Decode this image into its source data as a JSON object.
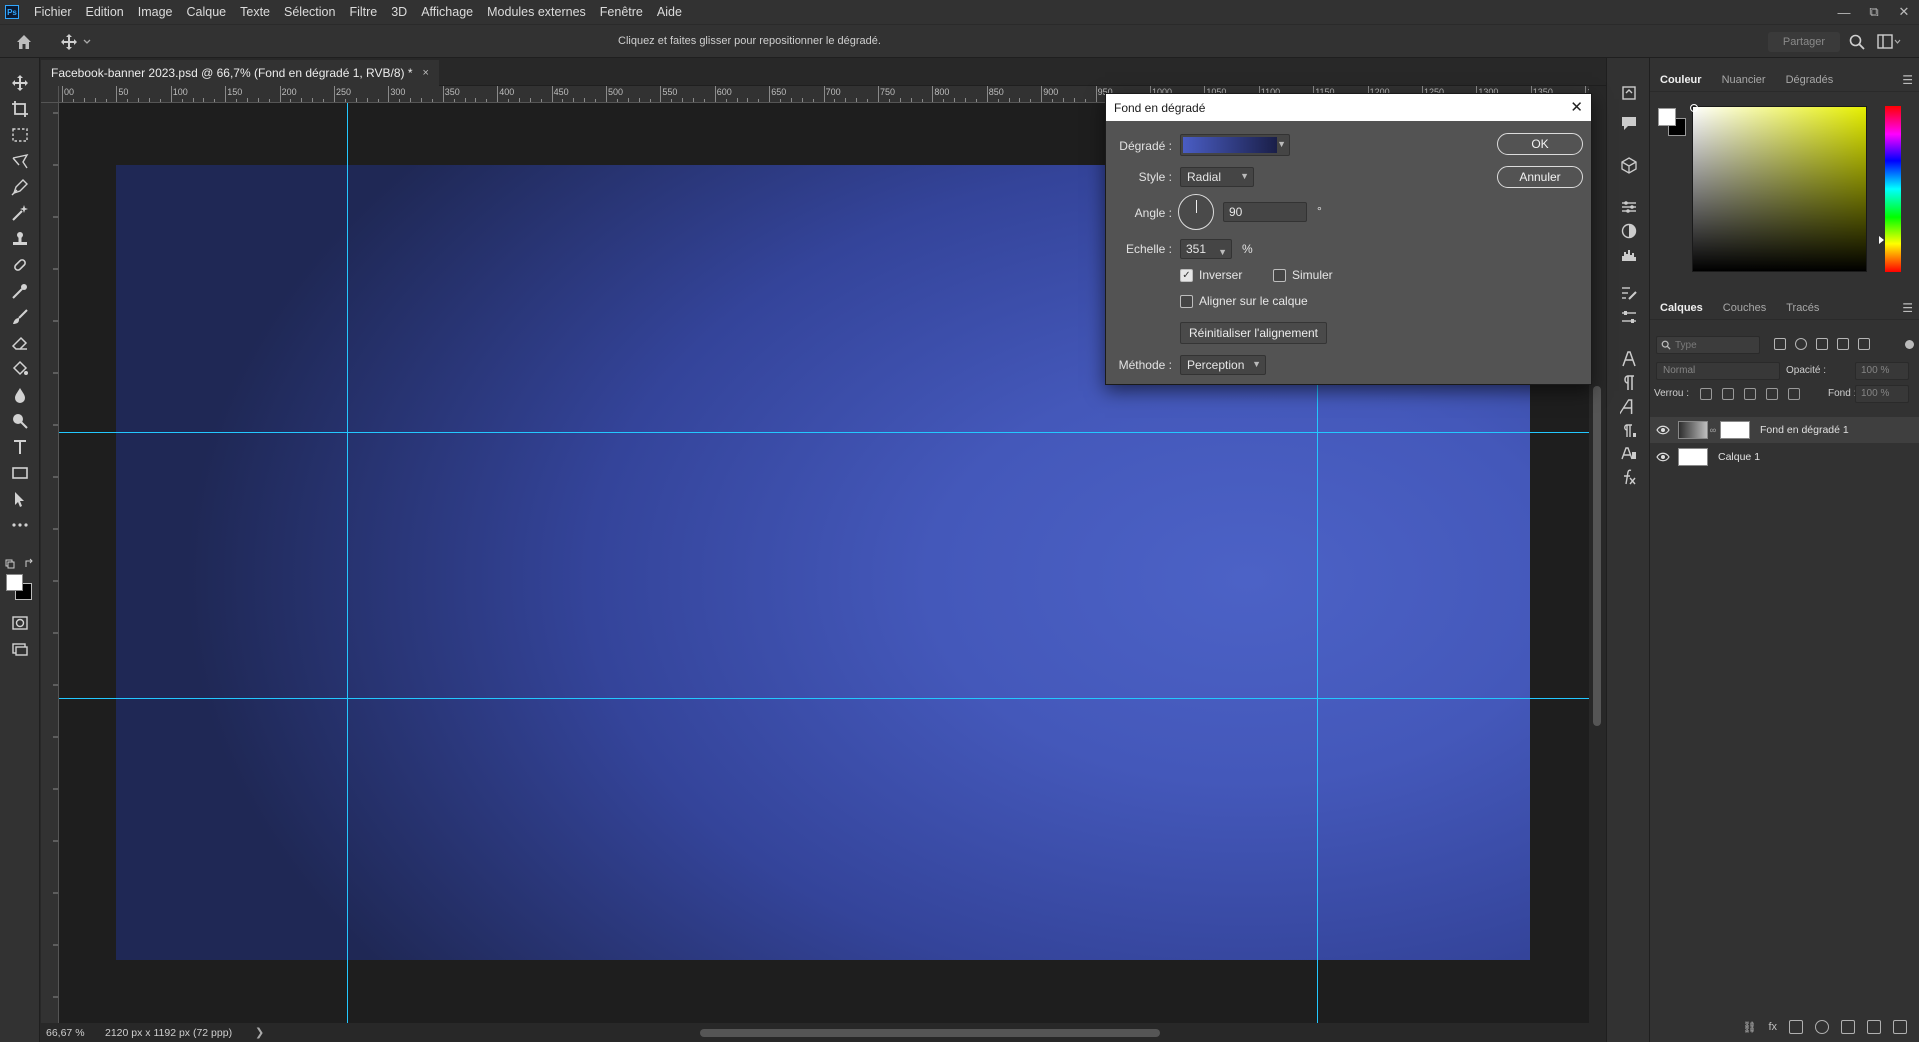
{
  "app": {
    "logo_text": "Ps",
    "menu": [
      "Fichier",
      "Edition",
      "Image",
      "Calque",
      "Texte",
      "Sélection",
      "Filtre",
      "3D",
      "Affichage",
      "Modules externes",
      "Fenêtre",
      "Aide"
    ],
    "window_controls": {
      "minimize": "—",
      "restore": "⧉",
      "close": "✕"
    }
  },
  "options_bar": {
    "hint": "Cliquez et faites glisser pour repositionner le dégradé.",
    "share_label": "Partager"
  },
  "document": {
    "tab_title": "Facebook-banner 2023.psd @ 66,7% (Fond en dégradé 1, RVB/8) *",
    "tab_close": "×"
  },
  "rulers": {
    "top_labels": [
      "00",
      "50",
      "100",
      "150",
      "200",
      "250",
      "300",
      "350",
      "400",
      "450",
      "500",
      "550",
      "600",
      "650",
      "700",
      "750",
      "800",
      "850",
      "900",
      "950",
      "1000",
      "1050",
      "1100",
      "1150",
      "1200",
      "1250",
      "1300",
      "1350",
      "1400",
      "1450"
    ]
  },
  "status": {
    "zoom": "66,67 %",
    "doc_size": "2120 px x 1192 px (72 ppp)",
    "arrow": "❯"
  },
  "color_panel": {
    "tabs": [
      "Couleur",
      "Nuancier",
      "Dégradés"
    ],
    "fg_color": "#ffffff",
    "bg_color": "#000000"
  },
  "layers_panel": {
    "tabs": [
      "Calques",
      "Couches",
      "Tracés"
    ],
    "filter_placeholder": "Type",
    "blend_mode": "Normal",
    "opacity_label": "Opacité :",
    "opacity_value": "100 %",
    "lock_label": "Verrou :",
    "fill_label": "Fond :",
    "fill_value": "100 %",
    "layers": [
      {
        "name": "Fond en dégradé 1",
        "selected": true
      },
      {
        "name": "Calque 1",
        "selected": false
      }
    ]
  },
  "dialog": {
    "title": "Fond en dégradé",
    "close": "✕",
    "gradient_label": "Dégradé :",
    "style_label": "Style :",
    "style_value": "Radial",
    "angle_label": "Angle :",
    "angle_value": "90",
    "angle_unit": "°",
    "scale_label": "Echelle :",
    "scale_value": "351",
    "scale_unit": "%",
    "reverse_label": "Inverser",
    "reverse_checked": true,
    "dither_label": "Simuler",
    "dither_checked": false,
    "align_label": "Aligner sur le calque",
    "align_checked": false,
    "reset_label": "Réinitialiser l'alignement",
    "method_label": "Méthode :",
    "method_value": "Perception",
    "ok_label": "OK",
    "cancel_label": "Annuler"
  }
}
